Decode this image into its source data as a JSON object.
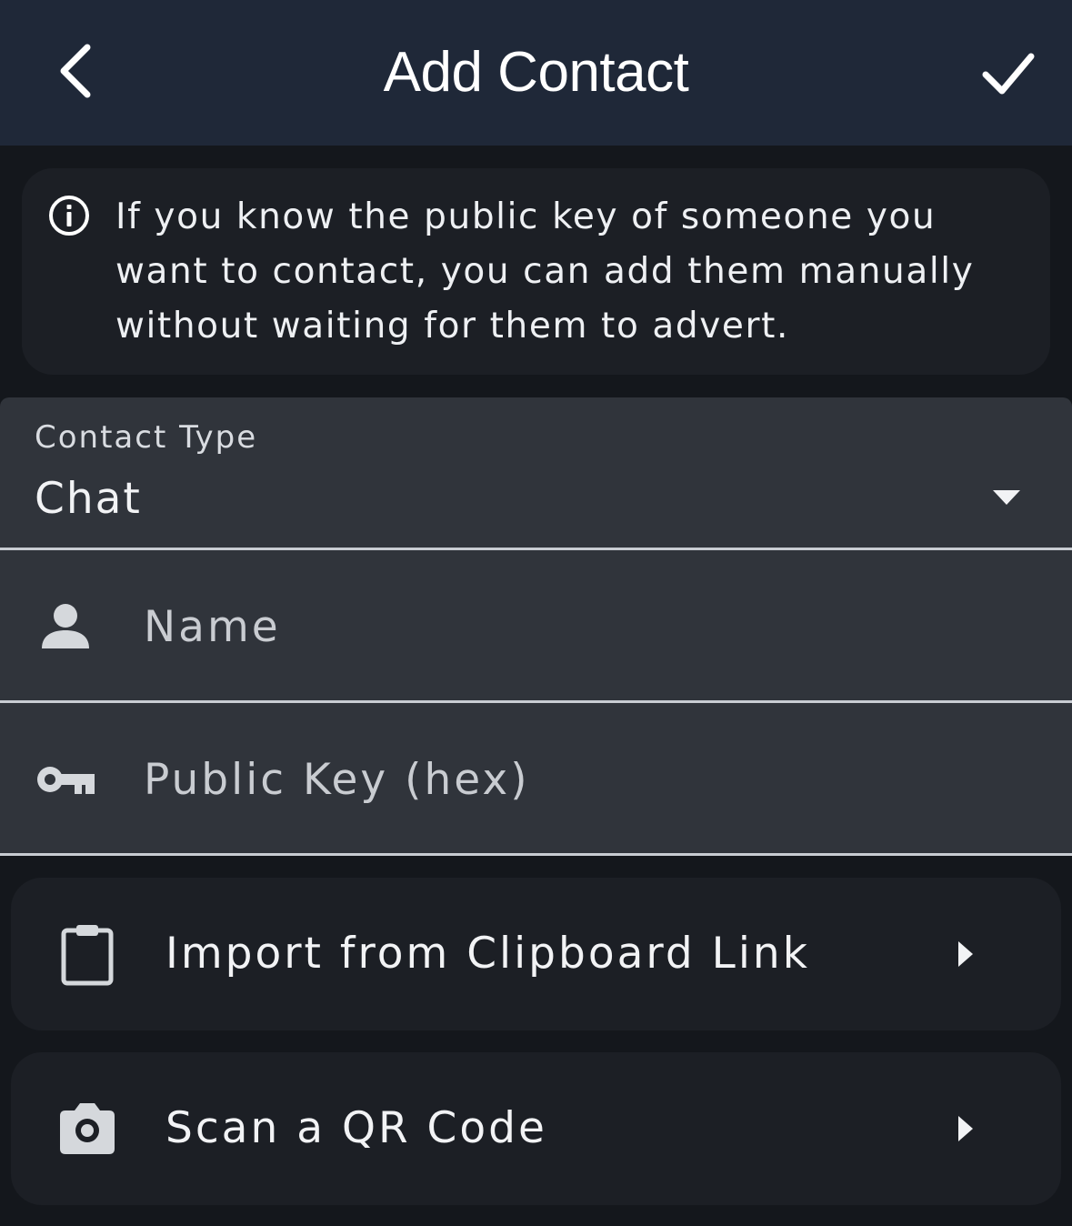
{
  "header": {
    "title": "Add Contact",
    "back_icon": "chevron-left-icon",
    "confirm_icon": "check-icon"
  },
  "info": {
    "icon": "info-icon",
    "text": "If you know the public key of someone you want to contact, you can add them manually without waiting for them to advert."
  },
  "form": {
    "contact_type": {
      "label": "Contact Type",
      "value": "Chat",
      "icon": "dropdown-arrow-icon"
    },
    "name": {
      "placeholder": "Name",
      "value": "",
      "icon": "person-icon"
    },
    "public_key": {
      "placeholder": "Public Key (hex)",
      "value": "",
      "icon": "key-icon"
    }
  },
  "actions": [
    {
      "label": "Import from Clipboard Link",
      "icon": "clipboard-icon"
    },
    {
      "label": "Scan a QR Code",
      "icon": "camera-icon"
    }
  ],
  "colors": {
    "header_bg": "#1f2838",
    "page_bg": "#14171c",
    "card_bg": "#1c1f25",
    "field_bg": "#30343b",
    "field_underline": "#c8ccd2"
  }
}
